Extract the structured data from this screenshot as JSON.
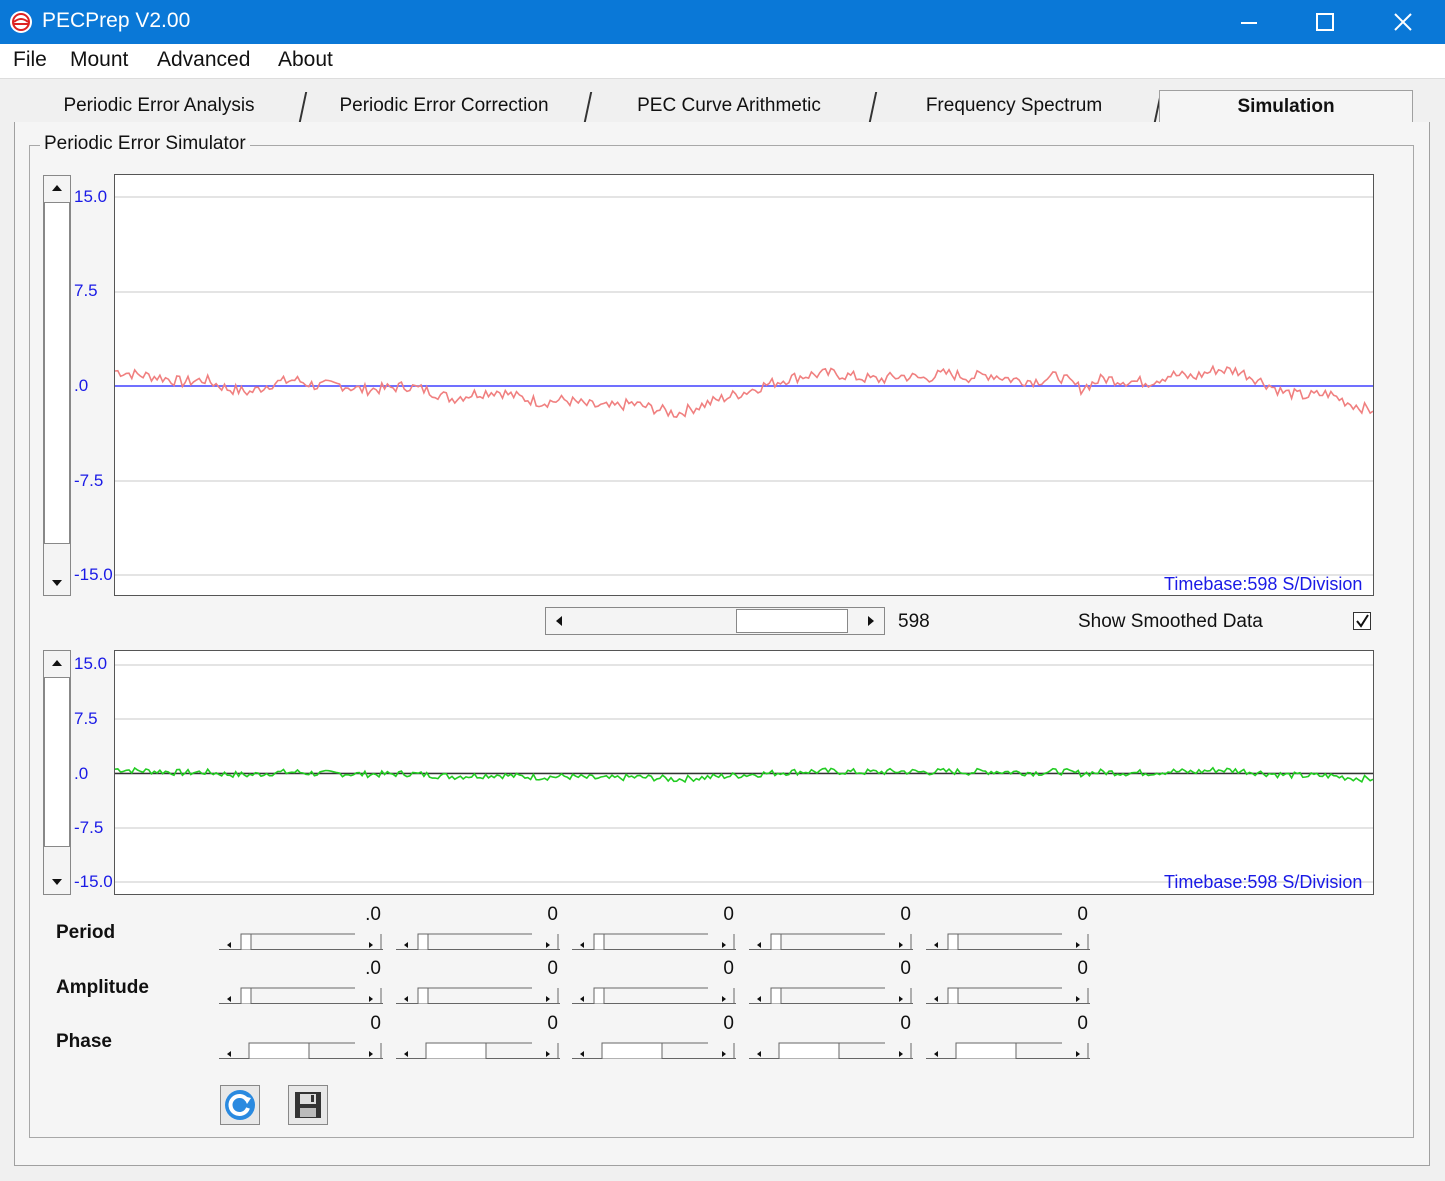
{
  "window": {
    "title": "PECPrep V2.00"
  },
  "menu": [
    "File",
    "Mount",
    "Advanced",
    "About"
  ],
  "tabs": [
    {
      "label": "Periodic Error Analysis",
      "active": false
    },
    {
      "label": "Periodic Error Correction",
      "active": false
    },
    {
      "label": "PEC Curve Arithmetic",
      "active": false
    },
    {
      "label": "Frequency Spectrum",
      "active": false
    },
    {
      "label": "Simulation",
      "active": true
    }
  ],
  "group": {
    "title": "Periodic Error Simulator"
  },
  "top_chart": {
    "ticks": [
      "15.0",
      "7.5",
      ".0",
      "-7.5",
      "-15.0"
    ],
    "timebase": "Timebase:598 S/Division",
    "trace_color": "#f08080",
    "zero_line_color": "#4040ff"
  },
  "bottom_chart": {
    "ticks": [
      "15.0",
      "7.5",
      ".0",
      "-7.5",
      "-15.0"
    ],
    "timebase": "Timebase:598 S/Division",
    "trace_color": "#22cc22",
    "zero_line_color": "#333333"
  },
  "timebase_control": {
    "value": "598"
  },
  "smoothing": {
    "label": "Show Smoothed Data",
    "checked": true
  },
  "params": {
    "period": {
      "label": "Period",
      "values": [
        ".0",
        "0",
        "0",
        "0",
        "0"
      ]
    },
    "amplitude": {
      "label": "Amplitude",
      "values": [
        ".0",
        "0",
        "0",
        "0",
        "0"
      ]
    },
    "phase": {
      "label": "Phase",
      "values": [
        "0",
        "0",
        "0",
        "0",
        "0"
      ]
    }
  },
  "chart_data": [
    {
      "type": "line",
      "ylim": [
        -15,
        15
      ],
      "yticks": [
        15,
        7.5,
        0,
        -7.5,
        -15
      ],
      "series": [
        {
          "color": "#f08080",
          "values": [
            1.2,
            0.9,
            0.7,
            0.3,
            0.5,
            -0.2,
            -0.5,
            0.2,
            0.5,
            0.0,
            0.1,
            -0.3,
            -0.2,
            0.0,
            -0.4,
            -1.0,
            -0.6,
            -0.4,
            -0.9,
            -1.3,
            -1.1,
            -1.5,
            -1.7,
            -1.4,
            -1.8,
            -2.2,
            -1.6,
            -1.0,
            -0.5,
            0.1,
            0.6,
            0.9,
            1.0,
            0.7,
            0.5,
            0.8,
            0.6,
            1.0,
            0.7,
            0.9,
            0.5,
            0.4,
            0.8,
            -0.2,
            0.6,
            0.4,
            0.3,
            0.9,
            0.7,
            1.3,
            1.2,
            0.4,
            -0.5,
            -0.8,
            -0.6,
            -1.4,
            -2.0
          ]
        }
      ]
    },
    {
      "type": "line",
      "ylim": [
        -15,
        15
      ],
      "yticks": [
        15,
        7.5,
        0,
        -7.5,
        -15
      ],
      "series": [
        {
          "color": "#22cc22",
          "values": [
            0.6,
            0.4,
            0.3,
            0.1,
            0.2,
            -0.1,
            -0.2,
            0.1,
            0.2,
            0.0,
            0.0,
            -0.1,
            -0.1,
            0.0,
            -0.2,
            -0.4,
            -0.3,
            -0.2,
            -0.4,
            -0.5,
            -0.4,
            -0.6,
            -0.7,
            -0.5,
            -0.6,
            -0.8,
            -0.6,
            -0.4,
            -0.2,
            0.0,
            0.2,
            0.3,
            0.3,
            0.2,
            0.2,
            0.3,
            0.2,
            0.3,
            0.2,
            0.3,
            0.2,
            0.1,
            0.3,
            0.0,
            0.2,
            0.1,
            0.1,
            0.3,
            0.2,
            0.5,
            0.4,
            0.1,
            -0.2,
            -0.3,
            -0.3,
            -0.6,
            -0.8
          ]
        }
      ]
    }
  ]
}
